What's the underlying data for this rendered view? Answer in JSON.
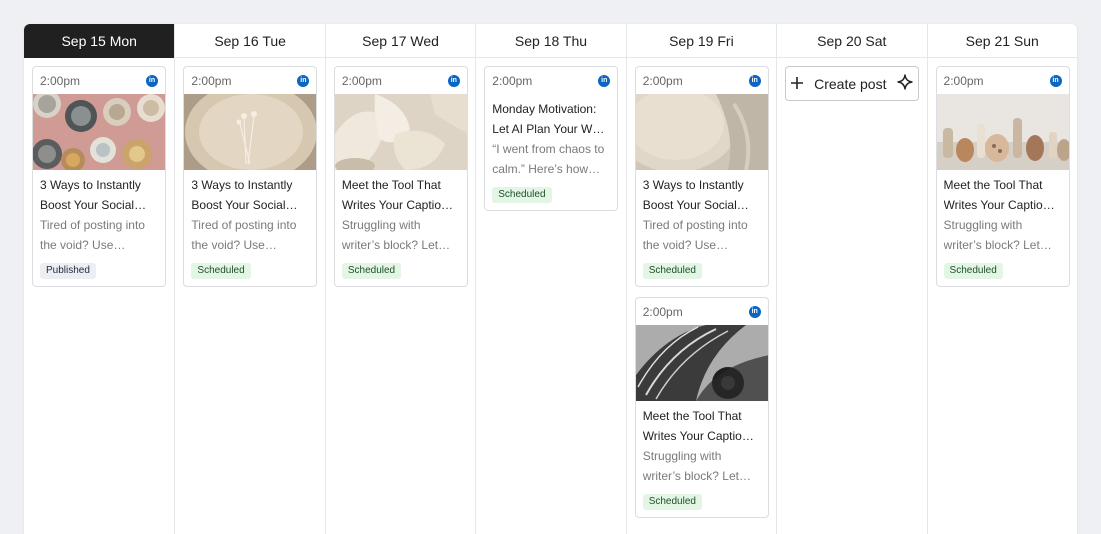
{
  "calendar": {
    "days": [
      {
        "label": "Sep 15 Mon",
        "active": true
      },
      {
        "label": "Sep 16 Tue"
      },
      {
        "label": "Sep 17 Wed"
      },
      {
        "label": "Sep 18 Thu"
      },
      {
        "label": "Sep 19 Fri"
      },
      {
        "label": "Sep 20 Sat"
      },
      {
        "label": "Sep 21 Sun"
      }
    ]
  },
  "posts": {
    "mon1": {
      "time": "2:00pm",
      "network": "in",
      "title": "3 Ways to Instantly Boost Your Social…",
      "desc": "Tired of posting into the void? Use these…",
      "status": "Published"
    },
    "tue1": {
      "time": "2:00pm",
      "network": "in",
      "title": "3 Ways to Instantly Boost Your Social…",
      "desc": "Tired of posting into the void? Use these…",
      "status": "Scheduled"
    },
    "wed1": {
      "time": "2:00pm",
      "network": "in",
      "title": "Meet the Tool That Writes Your Captio…",
      "desc": "Struggling with writer’s block? Let…",
      "status": "Scheduled"
    },
    "thu1": {
      "time": "2:00pm",
      "network": "in",
      "title": "Monday Motivation: Let AI Plan Your W…",
      "desc": "“I went from chaos to calm.” Here’s how…",
      "status": "Scheduled"
    },
    "fri1": {
      "time": "2:00pm",
      "network": "in",
      "title": "3 Ways to Instantly Boost Your Social…",
      "desc": "Tired of posting into the void? Use these…",
      "status": "Scheduled"
    },
    "fri2": {
      "time": "2:00pm",
      "network": "in",
      "title": "Meet the Tool That Writes Your Captio…",
      "desc": "Struggling with writer’s block? Let…",
      "status": "Scheduled"
    },
    "sun1": {
      "time": "2:00pm",
      "network": "in",
      "title": "Meet the Tool That Writes Your Captio…",
      "desc": "Struggling with writer’s block? Let…",
      "status": "Scheduled"
    }
  },
  "create_post": {
    "label": "Create post",
    "icons": [
      "plus-icon",
      "sparkle-icon"
    ]
  },
  "colors": {
    "active_header": "#202020",
    "linkedin": "#0a66c2",
    "scheduled_bg": "#e3f6e5",
    "published_bg": "#eceef2"
  }
}
